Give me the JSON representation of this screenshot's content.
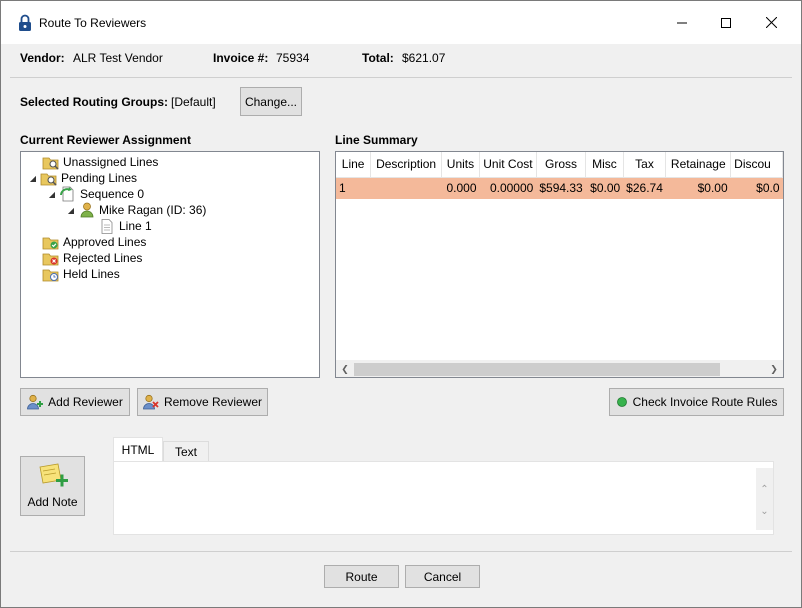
{
  "window": {
    "title": "Route To Reviewers"
  },
  "header": {
    "vendor_label": "Vendor:",
    "vendor_value": "ALR Test Vendor",
    "invoice_label": "Invoice #:",
    "invoice_value": "75934",
    "total_label": "Total:",
    "total_value": "$621.07"
  },
  "routing": {
    "label": "Selected Routing Groups:",
    "value": "[Default]",
    "change_button": "Change..."
  },
  "reviewer_assignment": {
    "label": "Current Reviewer Assignment",
    "tree": [
      {
        "label": "Unassigned Lines",
        "icon": "folder-search-icon",
        "expander": ""
      },
      {
        "label": "Pending Lines",
        "icon": "folder-search-icon",
        "expander": "◢"
      },
      {
        "label": "Sequence 0",
        "icon": "sequence-icon",
        "expander": "◢"
      },
      {
        "label": "Mike Ragan (ID: 36)",
        "icon": "user-icon",
        "expander": "◢"
      },
      {
        "label": "Line 1",
        "icon": "document-icon",
        "expander": ""
      },
      {
        "label": "Approved Lines",
        "icon": "folder-check-icon",
        "expander": ""
      },
      {
        "label": "Rejected Lines",
        "icon": "folder-reject-icon",
        "expander": ""
      },
      {
        "label": "Held Lines",
        "icon": "folder-clock-icon",
        "expander": ""
      }
    ]
  },
  "line_summary": {
    "label": "Line Summary",
    "columns": [
      "Line",
      "Description",
      "Units",
      "Unit Cost",
      "Gross",
      "Misc",
      "Tax",
      "Retainage",
      "Discou"
    ],
    "rows": [
      [
        "1",
        "",
        "0.000",
        "0.00000",
        "$594.33",
        "$0.00",
        "$26.74",
        "$0.00",
        "$0.0"
      ]
    ],
    "highlight_color": "#f4b99a"
  },
  "actions": {
    "add_reviewer": "Add Reviewer",
    "remove_reviewer": "Remove Reviewer",
    "check_route_rules": "Check Invoice Route Rules",
    "status_dot_color": "#37b24d"
  },
  "notes": {
    "add_note": "Add Note",
    "tabs": [
      "HTML",
      "Text"
    ],
    "active_tab": "HTML"
  },
  "footer": {
    "route": "Route",
    "cancel": "Cancel"
  }
}
